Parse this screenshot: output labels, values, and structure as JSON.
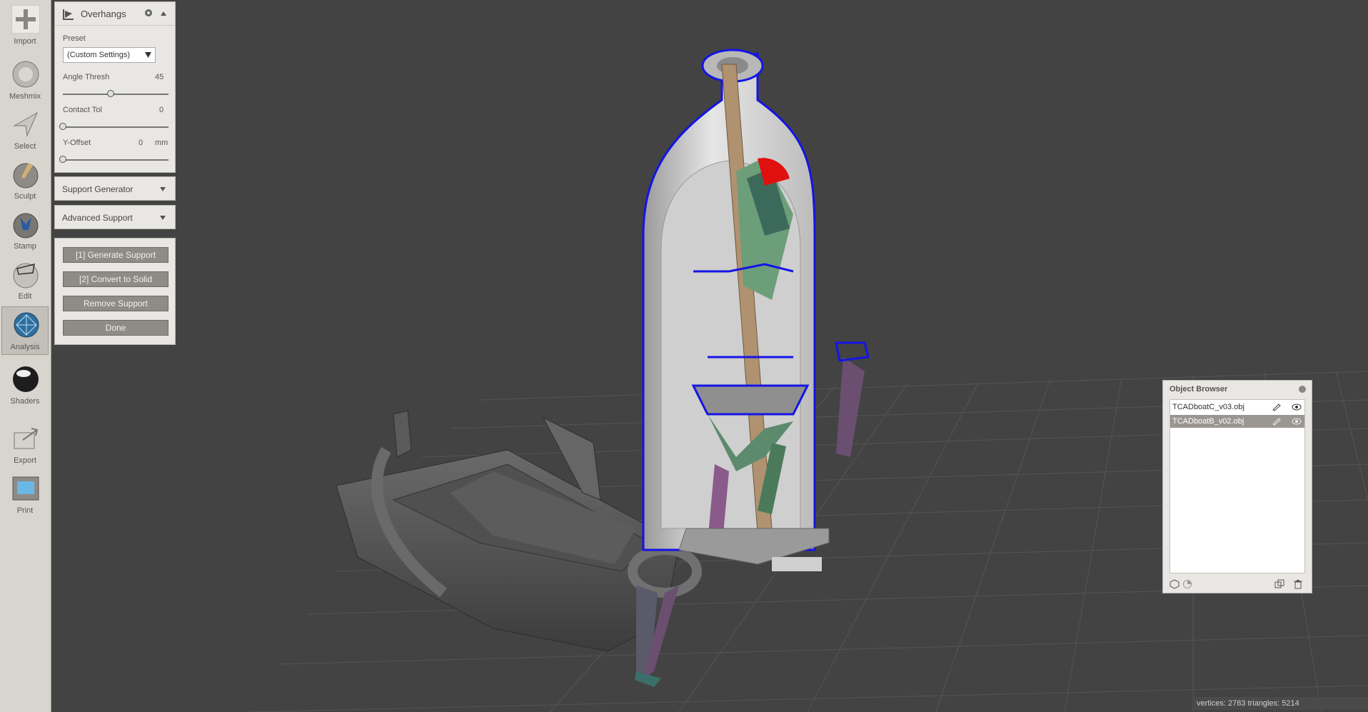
{
  "toolbar": {
    "items": [
      {
        "label": "Import",
        "icon": "plus-icon"
      },
      {
        "label": "Meshmix",
        "icon": "meshmix-icon"
      },
      {
        "label": "Select",
        "icon": "select-arrow-icon"
      },
      {
        "label": "Sculpt",
        "icon": "sculpt-brush-icon"
      },
      {
        "label": "Stamp",
        "icon": "stamp-icon"
      },
      {
        "label": "Edit",
        "icon": "edit-icon"
      },
      {
        "label": "Analysis",
        "icon": "analysis-icon"
      },
      {
        "label": "Shaders",
        "icon": "shaders-sphere-icon"
      },
      {
        "label": "Export",
        "icon": "export-icon"
      },
      {
        "label": "Print",
        "icon": "print-icon"
      }
    ],
    "active": "Analysis"
  },
  "overhangs": {
    "title": "Overhangs",
    "preset_label": "Preset",
    "preset_value": "(Custom Settings)",
    "angle_thresh_label": "Angle Thresh",
    "angle_thresh_value": "45",
    "angle_thresh_fraction": 0.45,
    "contact_tol_label": "Contact Tol",
    "contact_tol_value": "0",
    "contact_tol_fraction": 0,
    "y_offset_label": "Y-Offset",
    "y_offset_value": "0",
    "y_offset_unit": "mm",
    "y_offset_fraction": 0
  },
  "support_generator": {
    "title": "Support Generator"
  },
  "advanced_support": {
    "title": "Advanced Support"
  },
  "actions": {
    "generate": "[1] Generate Support",
    "convert": "[2] Convert to Solid",
    "remove": "Remove Support",
    "done": "Done"
  },
  "object_browser": {
    "title": "Object Browser",
    "objects": [
      {
        "name": "TCADboatC_v03.obj",
        "selected": false
      },
      {
        "name": "TCADboatB_v02.obj",
        "selected": true
      }
    ]
  },
  "status": {
    "text": "vertices: 2783 triangles: 5214"
  },
  "colors": {
    "background": "#434343",
    "panel": "#e9e7e3",
    "button": "#8f8b87",
    "overhang_outline": "#1414e6",
    "support_strut": "#b09270"
  }
}
